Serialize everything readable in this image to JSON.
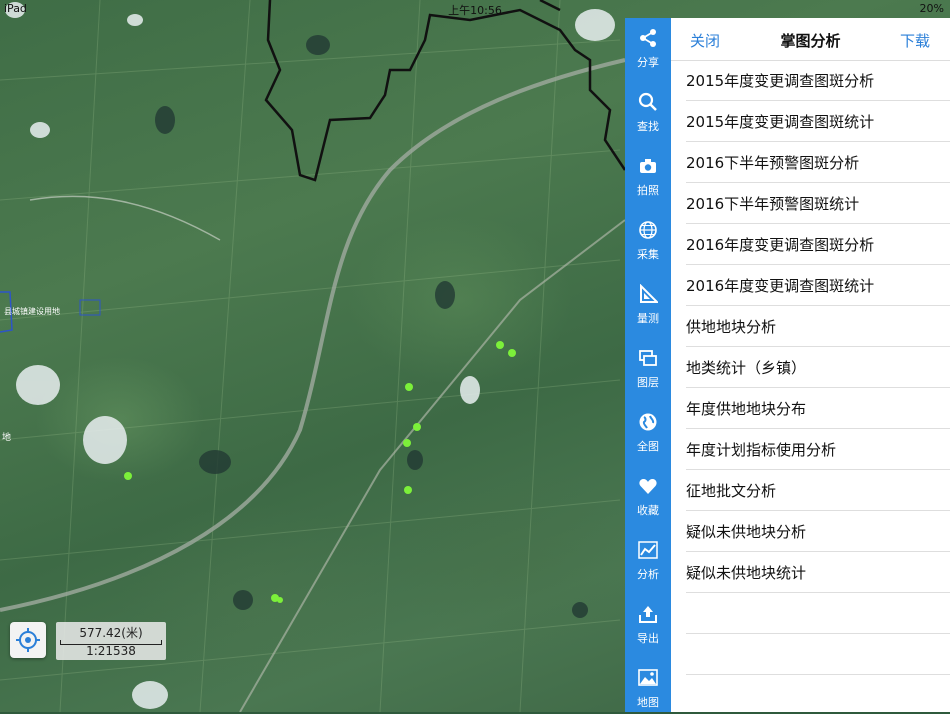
{
  "status_bar": {
    "device": "iPad",
    "time": "上午10:56",
    "battery": "20%"
  },
  "map": {
    "scale_distance": "577.42(米)",
    "scale_ratio": "1:21538",
    "place_label": "县城镇建设用地",
    "side_label": "地"
  },
  "toolbar": [
    {
      "icon": "share-icon",
      "label": "分享"
    },
    {
      "icon": "search-icon",
      "label": "查找"
    },
    {
      "icon": "camera-icon",
      "label": "拍照"
    },
    {
      "icon": "globe-grid-icon",
      "label": "采集"
    },
    {
      "icon": "ruler-icon",
      "label": "量测"
    },
    {
      "icon": "layers-icon",
      "label": "图层"
    },
    {
      "icon": "globe-icon",
      "label": "全图"
    },
    {
      "icon": "heart-icon",
      "label": "收藏"
    },
    {
      "icon": "chart-icon",
      "label": "分析"
    },
    {
      "icon": "export-icon",
      "label": "导出"
    },
    {
      "icon": "map-icon",
      "label": "地图"
    }
  ],
  "panel": {
    "close_label": "关闭",
    "title": "掌图分析",
    "download_label": "下载",
    "items": [
      "2015年度变更调查图斑分析",
      "2015年度变更调查图斑统计",
      "2016下半年预警图斑分析",
      "2016下半年预警图斑统计",
      "2016年度变更调查图斑分析",
      "2016年度变更调查图斑统计",
      "供地地块分析",
      "地类统计（乡镇）",
      "年度供地地块分布",
      "年度计划指标使用分析",
      "征地批文分析",
      "疑似未供地块分析",
      "疑似未供地块统计",
      "",
      ""
    ]
  },
  "colors": {
    "accent": "#2b8ae0",
    "link": "#2b7fd8",
    "marker": "#7cf03a"
  }
}
